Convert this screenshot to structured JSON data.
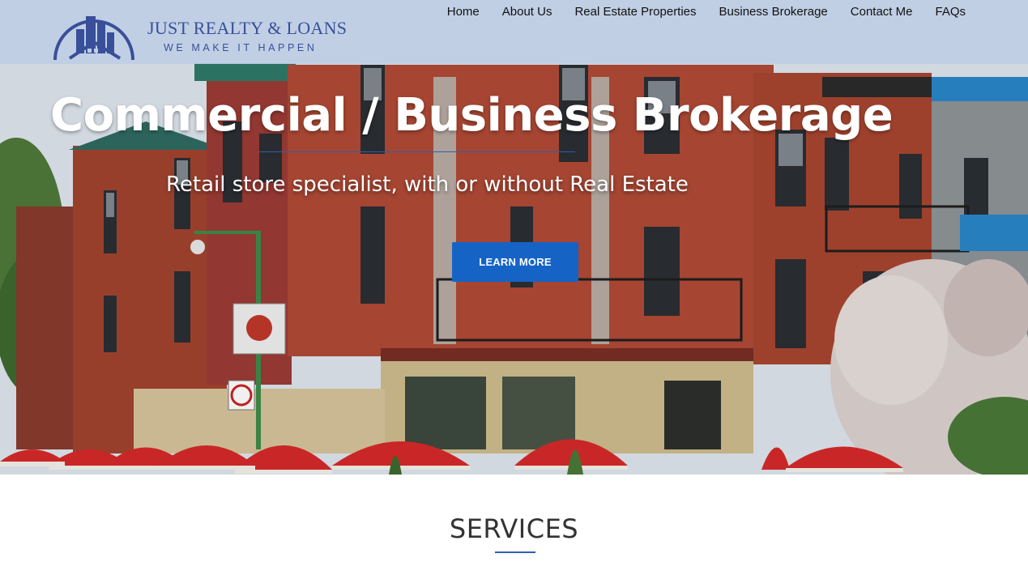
{
  "header": {
    "logo": {
      "name": "JUST REALTY & LOANS",
      "tagline": "WE MAKE IT HAPPEN"
    },
    "nav": [
      {
        "label": "Home"
      },
      {
        "label": "About Us"
      },
      {
        "label": "Real Estate Properties"
      },
      {
        "label": "Business Brokerage"
      },
      {
        "label": "Contact Me"
      },
      {
        "label": "FAQs"
      }
    ]
  },
  "hero": {
    "title": "Commercial / Business Brokerage",
    "subtitle": "Retail store specialist, with or without Real Estate",
    "cta_label": "LEARN MORE"
  },
  "services": {
    "heading": "SERVICES"
  },
  "colors": {
    "brand_blue": "#3a4f9a",
    "cta_blue": "#1663c6",
    "header_bg": "#becee4",
    "accent_line": "#2f5fb3"
  },
  "icons": {
    "logo_mark": "house-skyline-icon"
  }
}
